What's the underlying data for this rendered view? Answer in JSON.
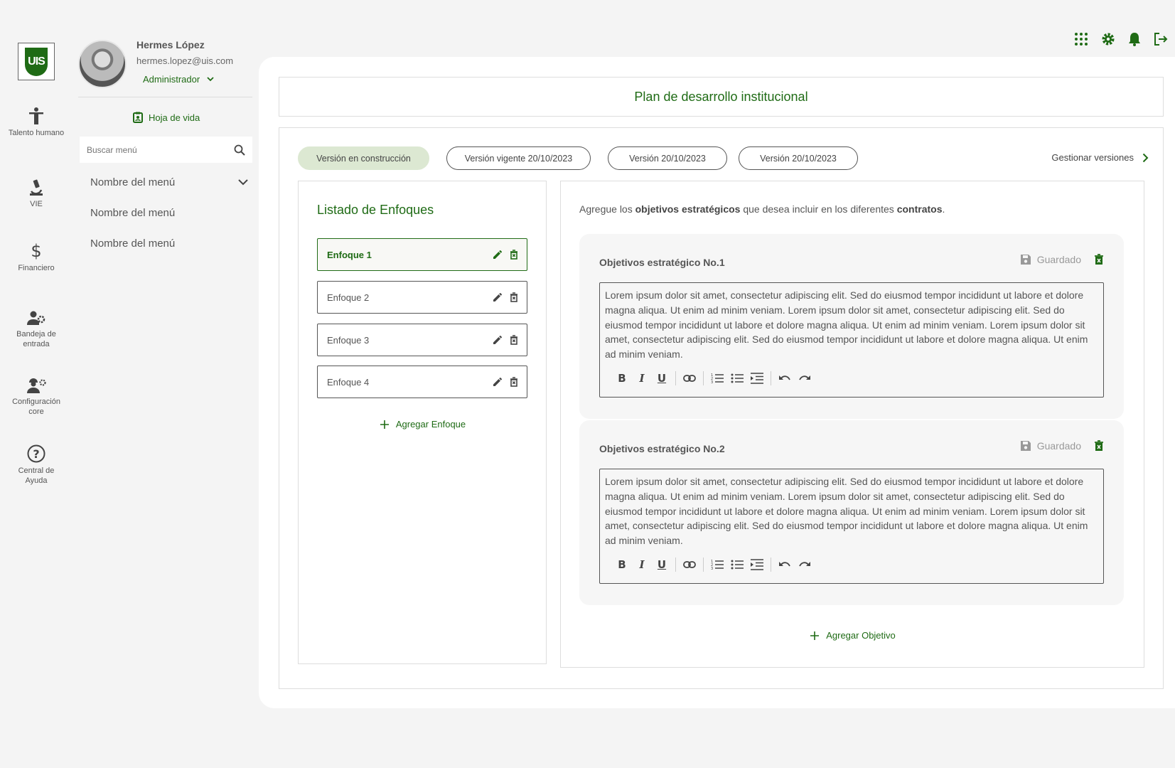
{
  "app": {
    "logo_text": "UIS"
  },
  "rail": [
    {
      "label": "Talento humano",
      "icon": "person-icon"
    },
    {
      "label": "VIE",
      "icon": "microscope-icon"
    },
    {
      "label": "Financiero",
      "icon": "dollar-icon"
    },
    {
      "label": "Bandeja de entrada",
      "icon": "users-gear-icon"
    },
    {
      "label": "Configuración core",
      "icon": "worker-gear-icon"
    },
    {
      "label": "Central de Ayuda",
      "icon": "help-icon"
    }
  ],
  "user": {
    "name": "Hermes López",
    "email": "hermes.lopez@uis.com",
    "role": "Administrador",
    "hoja_de_vida": "Hoja de vida"
  },
  "search": {
    "placeholder": "Buscar menú"
  },
  "menu": [
    "Nombre del menú",
    "Nombre del menú",
    "Nombre del menú"
  ],
  "page": {
    "title": "Plan de desarrollo institucional"
  },
  "versions": {
    "tabs": [
      {
        "label": "Versión en construcción",
        "active": true
      },
      {
        "label": "Versión vigente 20/10/2023",
        "active": false
      },
      {
        "label": "Versión 20/10/2023",
        "active": false
      },
      {
        "label": "Versión 20/10/2023",
        "active": false
      }
    ],
    "manage_label": "Gestionar versiones"
  },
  "enfoques": {
    "title": "Listado de Enfoques",
    "items": [
      {
        "label": "Enfoque 1",
        "active": true
      },
      {
        "label": "Enfoque 2",
        "active": false
      },
      {
        "label": "Enfoque 3",
        "active": false
      },
      {
        "label": "Enfoque 4",
        "active": false
      }
    ],
    "add_label": "Agregar Enfoque"
  },
  "objetivos": {
    "intro_prefix": "Agregue los ",
    "intro_bold1": "objetivos estratégicos",
    "intro_mid": " que desea incluir en los diferentes ",
    "intro_bold2": "contratos",
    "intro_suffix": ".",
    "items": [
      {
        "title": "Objetivos estratégico No.1",
        "status": "Guardado",
        "text": "Lorem ipsum dolor sit amet, consectetur adipiscing elit. Sed do eiusmod tempor incididunt ut labore et dolore magna aliqua. Ut enim ad minim veniam. Lorem ipsum dolor sit amet, consectetur adipiscing elit. Sed do eiusmod tempor incididunt ut labore et dolore magna aliqua. Ut enim ad minim veniam. Lorem ipsum dolor sit amet, consectetur adipiscing elit. Sed do eiusmod tempor incididunt ut labore et dolore magna aliqua. Ut enim ad minim veniam."
      },
      {
        "title": "Objetivos estratégico No.2",
        "status": "Guardado",
        "text": "Lorem ipsum dolor sit amet, consectetur adipiscing elit. Sed do eiusmod tempor incididunt ut labore et dolore magna aliqua. Ut enim ad minim veniam. Lorem ipsum dolor sit amet, consectetur adipiscing elit. Sed do eiusmod tempor incididunt ut labore et dolore magna aliqua. Ut enim ad minim veniam. Lorem ipsum dolor sit amet, consectetur adipiscing elit. Sed do eiusmod tempor incididunt ut labore et dolore magna aliqua. Ut enim ad minim veniam."
      }
    ],
    "add_label": "Agregar Objetivo"
  },
  "colors": {
    "brand": "#1f6b15",
    "active_tab_bg": "#dce8d2"
  }
}
